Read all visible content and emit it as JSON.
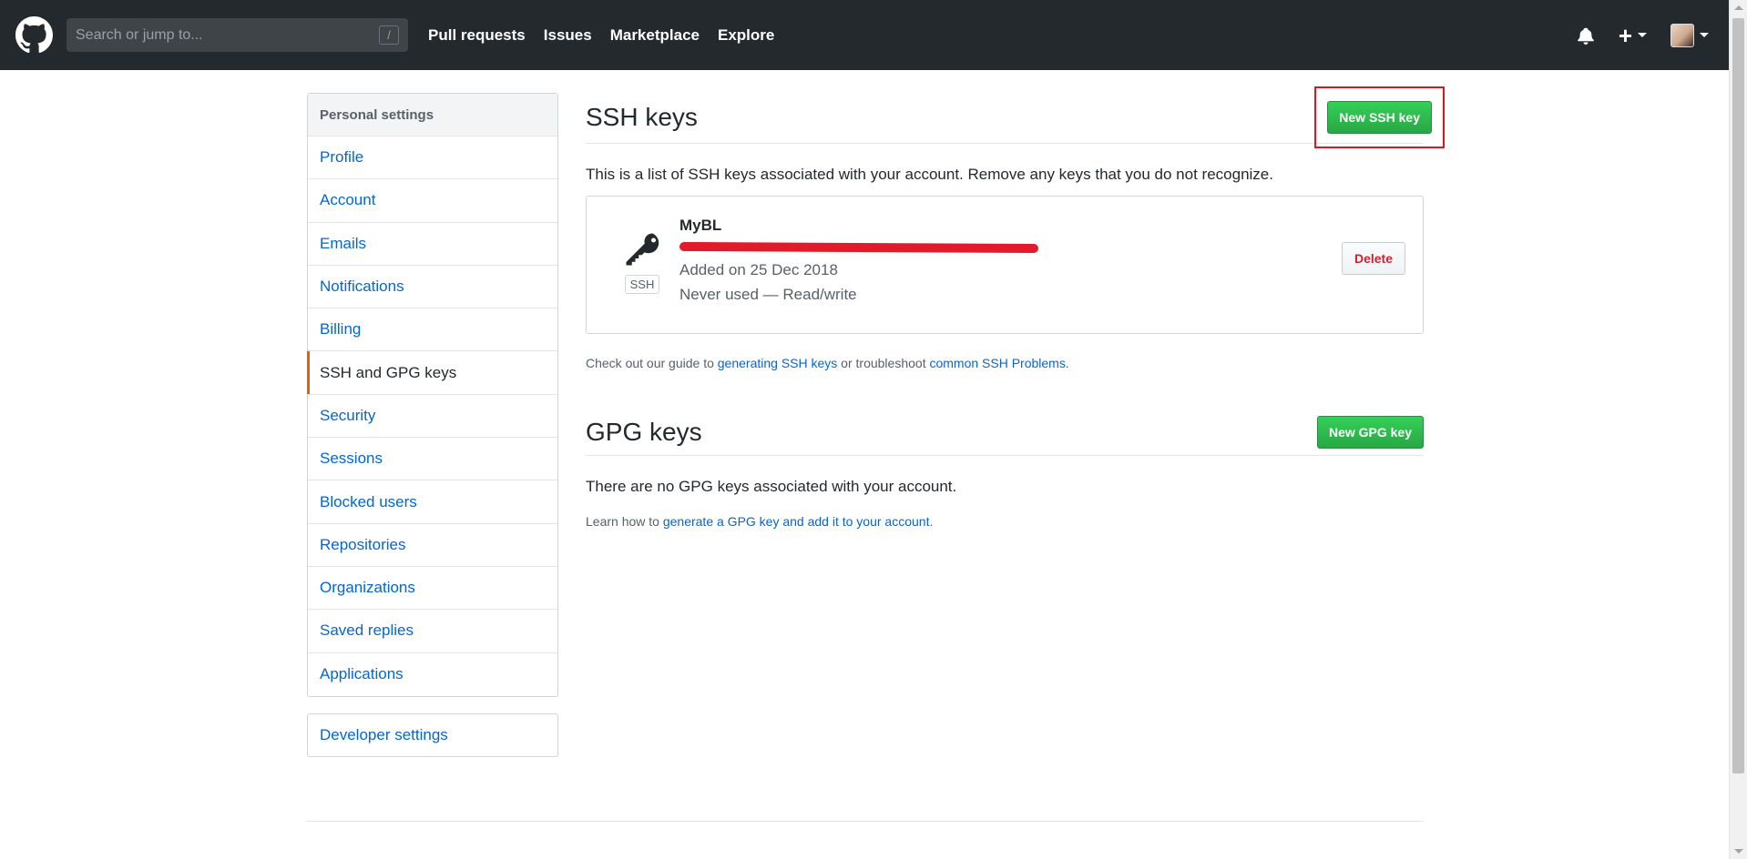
{
  "header": {
    "search_placeholder": "Search or jump to...",
    "search_shortcut": "/",
    "nav": [
      "Pull requests",
      "Issues",
      "Marketplace",
      "Explore"
    ],
    "plus_label": "+"
  },
  "sidebar": {
    "heading": "Personal settings",
    "items": [
      {
        "label": "Profile"
      },
      {
        "label": "Account"
      },
      {
        "label": "Emails"
      },
      {
        "label": "Notifications"
      },
      {
        "label": "Billing"
      },
      {
        "label": "SSH and GPG keys",
        "selected": true
      },
      {
        "label": "Security"
      },
      {
        "label": "Sessions"
      },
      {
        "label": "Blocked users"
      },
      {
        "label": "Repositories"
      },
      {
        "label": "Organizations"
      },
      {
        "label": "Saved replies"
      },
      {
        "label": "Applications"
      }
    ],
    "developer": "Developer settings"
  },
  "ssh": {
    "title": "SSH keys",
    "new_button": "New SSH key",
    "intro": "This is a list of SSH keys associated with your account. Remove any keys that you do not recognize.",
    "key": {
      "title": "MyBL",
      "type": "SSH",
      "added": "Added on 25 Dec 2018",
      "usage": "Never used — Read/write",
      "delete": "Delete"
    },
    "help_prefix": "Check out our guide to ",
    "help_link1": "generating SSH keys",
    "help_middle": " or troubleshoot ",
    "help_link2": "common SSH Problems",
    "help_suffix": "."
  },
  "gpg": {
    "title": "GPG keys",
    "new_button": "New GPG key",
    "empty": "There are no GPG keys associated with your account.",
    "learn_prefix": "Learn how to ",
    "learn_link": "generate a GPG key and add it to your account",
    "learn_suffix": "."
  },
  "colors": {
    "header_bg": "#24292e",
    "link": "#0366d6",
    "green": "#28a745",
    "danger": "#cb2431",
    "selected_marker": "#e36209",
    "annotation_red": "#e2131e"
  }
}
